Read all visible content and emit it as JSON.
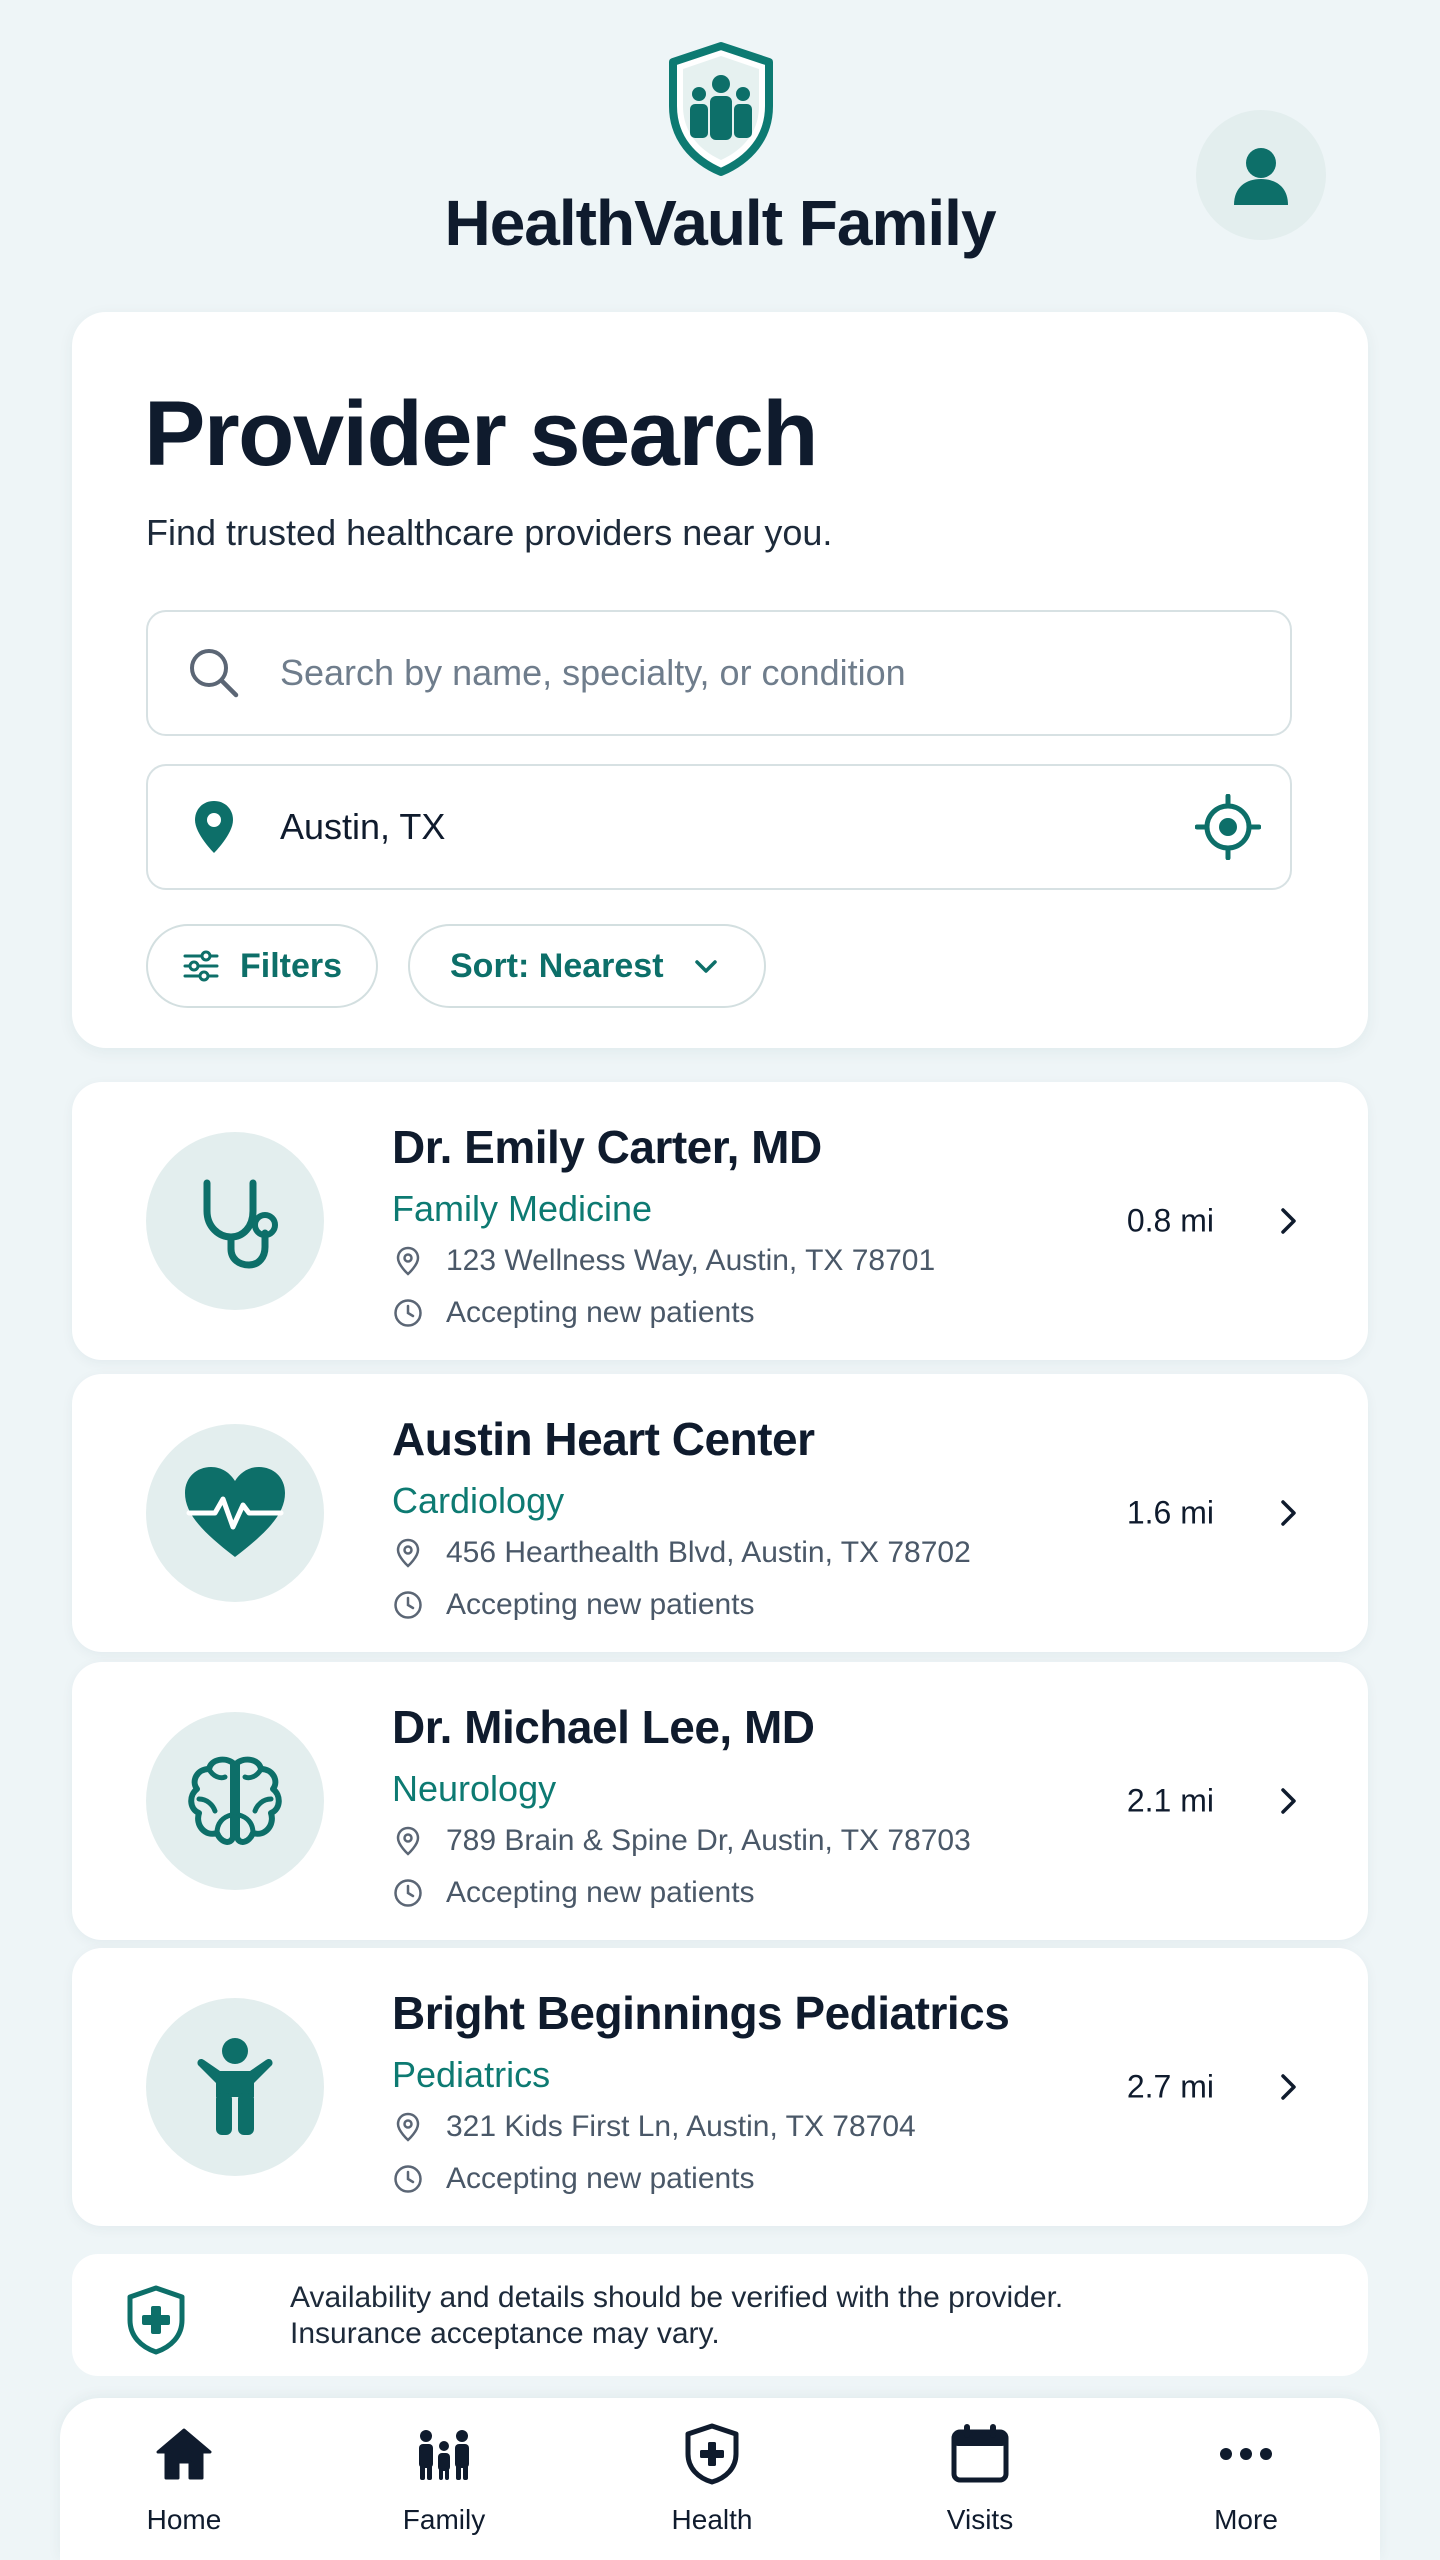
{
  "app": {
    "title": "HealthVault Family",
    "brand_color": "#0d7a72",
    "logo_icon": "family-shield-icon",
    "account_icon": "user-icon"
  },
  "search": {
    "page_title": "Provider search",
    "subtitle": "Find trusted healthcare providers near you.",
    "query_placeholder": "Search by name, specialty, or condition",
    "query_value": "",
    "location_value": "Austin, TX",
    "filters_label": "Filters",
    "sort_label": "Sort: Nearest"
  },
  "providers": [
    {
      "name": "Dr. Emily Carter, MD",
      "specialty": "Family Medicine",
      "address": "123 Wellness Way, Austin, TX 78701",
      "status": "Accepting new patients",
      "distance": "0.8 mi",
      "icon": "stethoscope-icon"
    },
    {
      "name": "Austin Heart Center",
      "specialty": "Cardiology",
      "address": "456 Hearthealth Blvd, Austin, TX 78702",
      "status": "Accepting new patients",
      "distance": "1.6 mi",
      "icon": "heart-pulse-icon"
    },
    {
      "name": "Dr. Michael Lee, MD",
      "specialty": "Neurology",
      "address": "789 Brain & Spine Dr, Austin, TX 78703",
      "status": "Accepting new patients",
      "distance": "2.1 mi",
      "icon": "brain-icon"
    },
    {
      "name": "Bright Beginnings Pediatrics",
      "specialty": "Pediatrics",
      "address": "321 Kids First Ln, Austin, TX 78704",
      "status": "Accepting new patients",
      "distance": "2.7 mi",
      "icon": "child-icon"
    }
  ],
  "notice": {
    "line1": "Availability and details should be verified with the provider.",
    "line2": "Insurance acceptance may vary."
  },
  "nav": [
    {
      "label": "Home",
      "icon": "home-icon"
    },
    {
      "label": "Family",
      "icon": "family-icon"
    },
    {
      "label": "Health",
      "icon": "health-shield-icon"
    },
    {
      "label": "Visits",
      "icon": "calendar-icon"
    },
    {
      "label": "More",
      "icon": "more-icon"
    }
  ]
}
